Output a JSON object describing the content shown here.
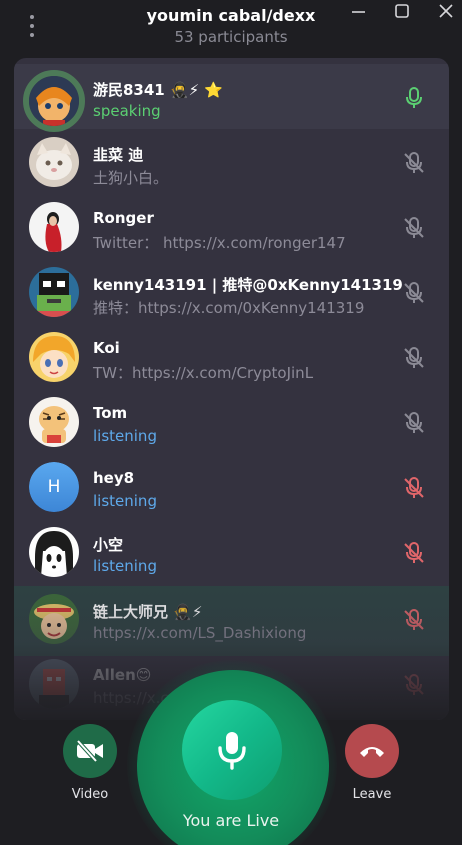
{
  "header": {
    "title": "youmin cabal/dexx",
    "subtitle": "53 participants"
  },
  "participants": [
    {
      "name": "游民8341 🥷⚡ ⭐",
      "status": "speaking",
      "status_type": "speaking",
      "mic": "active",
      "avatar": "anime-orange"
    },
    {
      "name": "韭菜 迪",
      "status": "土狗小白。",
      "status_type": "bio",
      "mic": "muted",
      "avatar": "cat"
    },
    {
      "name": "Ronger",
      "status": "Twitter： https://x.com/ronger147",
      "status_type": "bio",
      "mic": "muted",
      "avatar": "woman-red"
    },
    {
      "name": "kenny143191 | 推特@0xKenny141319",
      "status": "推特：https://x.com/0xKenny141319",
      "status_type": "bio",
      "mic": "muted",
      "avatar": "pixel"
    },
    {
      "name": "Koi",
      "status": "TW：https://x.com/CryptoJinL",
      "status_type": "bio",
      "mic": "muted",
      "avatar": "anime-blonde"
    },
    {
      "name": "Tom",
      "status": "listening",
      "status_type": "listening",
      "mic": "muted",
      "avatar": "tiger"
    },
    {
      "name": "hey8",
      "status": "listening",
      "status_type": "listening",
      "mic": "muted-red",
      "avatar": "letter",
      "initial": "H"
    },
    {
      "name": "小空",
      "status": "listening",
      "status_type": "listening",
      "mic": "muted-red",
      "avatar": "manga"
    },
    {
      "name": "链上大师兄 🥷⚡",
      "status": "https://x.com/LS_Dashixiong",
      "status_type": "bio",
      "mic": "muted-red",
      "avatar": "onepiece"
    },
    {
      "name": "Allen😊",
      "status": "https://x.com/wallenckchen",
      "status_type": "bio",
      "mic": "muted-red",
      "avatar": "punk"
    }
  ],
  "controls": {
    "video_label": "Video",
    "live_label": "You are Live",
    "leave_label": "Leave"
  },
  "colors": {
    "speaking": "#5bcf72",
    "listening": "#5ea9ea",
    "muted_red": "#e0666a",
    "muted_gray": "#8b8a95",
    "live_green": "#13b98a",
    "leave_red": "#b54a4e"
  }
}
